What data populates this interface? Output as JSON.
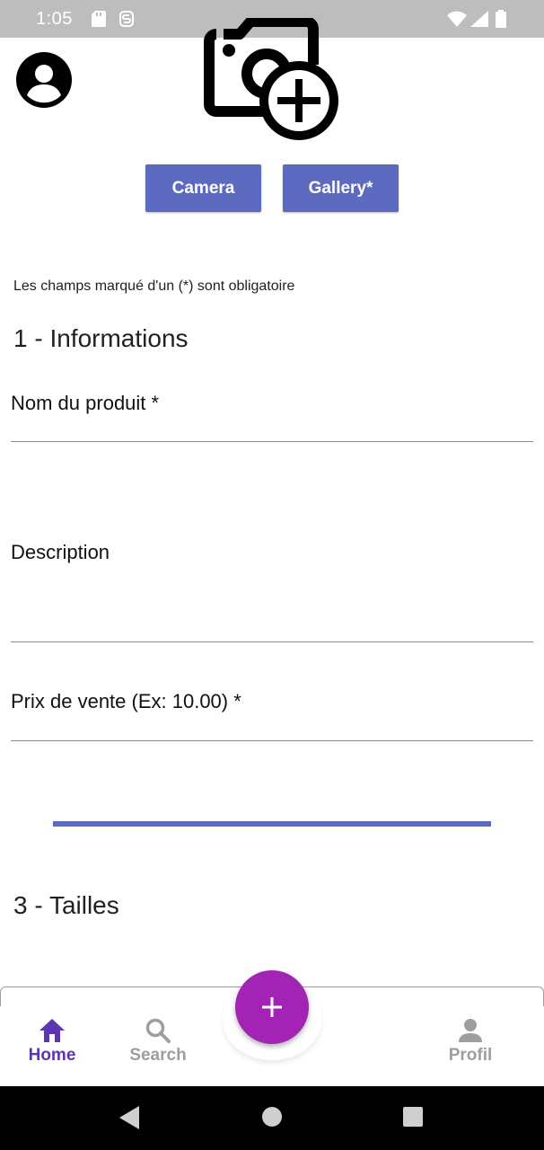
{
  "status_bar": {
    "time": "1:05"
  },
  "header": {
    "avatar_icon": "account-circle-icon",
    "camera_add_icon": "add-a-photo-icon"
  },
  "buttons": {
    "camera": "Camera",
    "gallery": "Gallery*"
  },
  "form": {
    "note": "Les champs marqué d'un (*) sont obligatoire",
    "section1": "1 - Informations",
    "fields": [
      {
        "label": "Nom du produit *",
        "value": ""
      },
      {
        "label": "Description",
        "value": ""
      },
      {
        "label": "Prix de vente (Ex: 10.00) *",
        "value": ""
      }
    ],
    "section3": "3 - Tailles"
  },
  "bottom_nav": {
    "items": [
      {
        "label": "Home",
        "icon": "home-icon",
        "active": true
      },
      {
        "label": "Search",
        "icon": "search-icon",
        "active": false
      },
      {
        "label": "Profil",
        "icon": "person-icon",
        "active": false
      }
    ],
    "fab_icon": "plus-icon"
  },
  "colors": {
    "accent": "#5c6bc0",
    "fab": "#a323b4",
    "nav_active": "#5e35b1",
    "nav_inactive": "#9e9e9e"
  }
}
